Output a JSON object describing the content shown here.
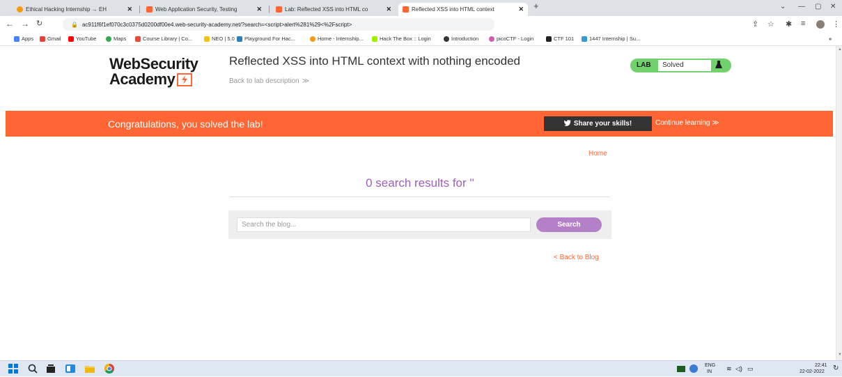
{
  "browser": {
    "tabs": [
      {
        "label": "Ethical Hacking Internship → EH",
        "active": false
      },
      {
        "label": "Web Application Security, Testing",
        "active": false
      },
      {
        "label": "Lab: Reflected XSS into HTML co",
        "active": false
      },
      {
        "label": "Reflected XSS into HTML context",
        "active": true
      }
    ],
    "url": "ac911f6f1ef070c3c0375d0200df00e4.web-security-academy.net/?search=<script>alert%281%29<%2Fscript>",
    "bookmarks": [
      "Apps",
      "Gmail",
      "YouTube",
      "Maps",
      "Course Library | Co...",
      "NEO | 5.0",
      "Playground For Hac...",
      "Home - Internship...",
      "Hack The Box :: Login",
      "Introduction",
      "picoCTF - Login",
      "CTF 101",
      "1447 Internship | Su..."
    ]
  },
  "header": {
    "logo_top": "WebSecurity",
    "logo_bottom": "Academy",
    "lab_title": "Reflected XSS into HTML context with nothing encoded",
    "back_link": "Back to lab description",
    "lab_badge": "LAB",
    "lab_status": "Solved"
  },
  "banner": {
    "message": "Congratulations, you solved the lab!",
    "share_label": "Share your skills!",
    "continue_label": "Continue learning"
  },
  "content": {
    "home_link": "Home",
    "results_text": "0 search results for ''",
    "search_placeholder": "Search the blog...",
    "search_button": "Search",
    "back_blog": "< Back to Blog"
  },
  "taskbar": {
    "lang_top": "ENG",
    "lang_bottom": "IN",
    "time": "22:41",
    "date": "22-02-2022"
  },
  "colors": {
    "accent": "#ff6633",
    "purple": "#9c5fb5",
    "lab_green": "#70d16d"
  }
}
